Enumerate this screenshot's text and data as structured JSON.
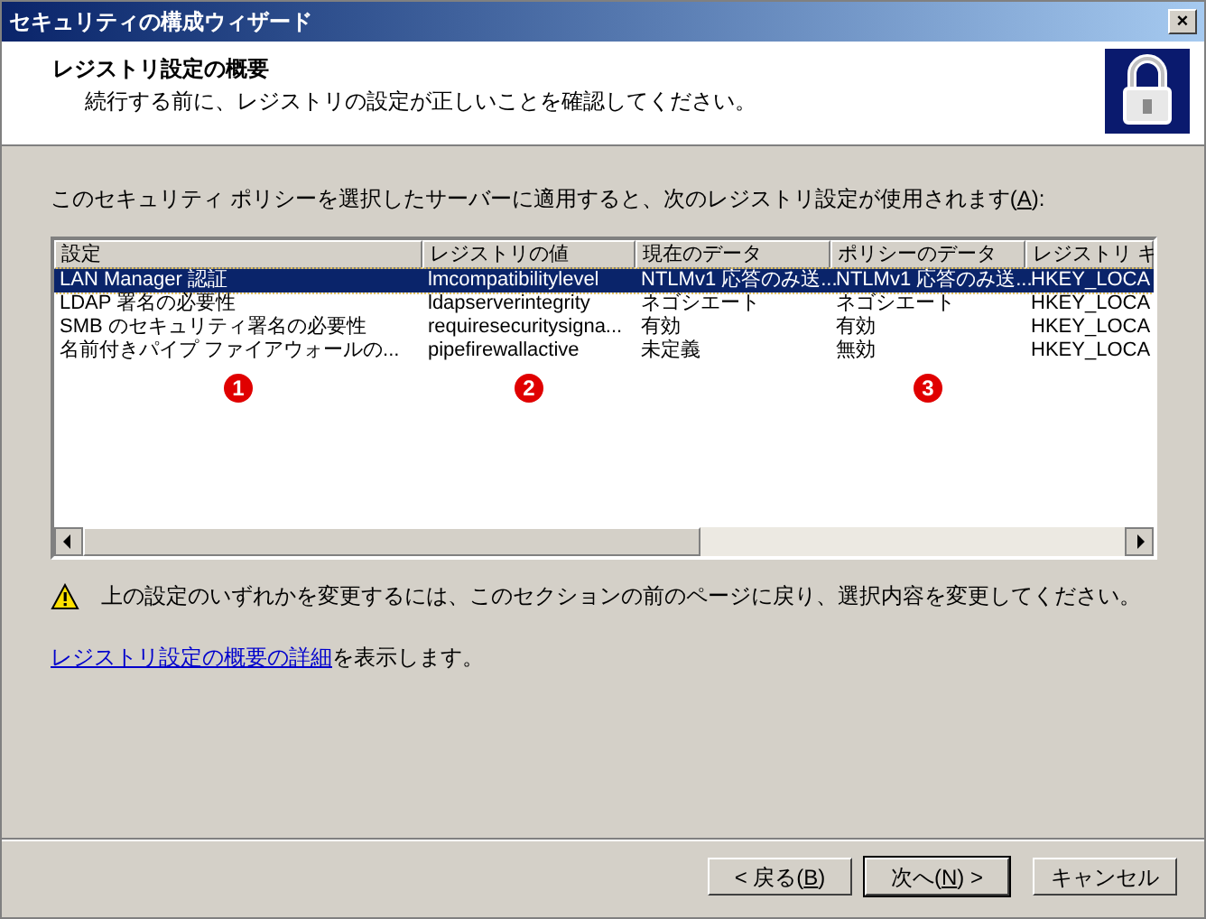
{
  "window": {
    "title": "セキュリティの構成ウィザード",
    "close": "×"
  },
  "header": {
    "title": "レジストリ設定の概要",
    "subtitle": "続行する前に、レジストリの設定が正しいことを確認してください。"
  },
  "intro": {
    "prefix": "このセキュリティ ポリシーを選択したサーバーに適用すると、次のレジストリ設定が使用されます(",
    "key": "A",
    "suffix": "):"
  },
  "table": {
    "columns": [
      "設定",
      "レジストリの値",
      "現在のデータ",
      "ポリシーのデータ",
      "レジストリ キ"
    ],
    "rows": [
      {
        "cells": [
          "LAN Manager 認証",
          "lmcompatibilitylevel",
          "NTLMv1 応答のみ送...",
          "NTLMv1 応答のみ送...",
          "HKEY_LOCA"
        ],
        "selected": true
      },
      {
        "cells": [
          "LDAP 署名の必要性",
          "ldapserverintegrity",
          "ネゴシエート",
          "ネゴシエート",
          "HKEY_LOCA"
        ],
        "selected": false
      },
      {
        "cells": [
          "SMB のセキュリティ署名の必要性",
          "requiresecuritysigna...",
          "有効",
          "有効",
          "HKEY_LOCA"
        ],
        "selected": false
      },
      {
        "cells": [
          "名前付きパイプ ファイアウォールの...",
          "pipefirewallactive",
          "未定義",
          "無効",
          "HKEY_LOCA"
        ],
        "selected": false
      }
    ],
    "markers": [
      "1",
      "2",
      "3"
    ]
  },
  "warning": "上の設定のいずれかを変更するには、このセクションの前のページに戻り、選択内容を変更してください。",
  "details": {
    "link": "レジストリ設定の概要の詳細",
    "suffix": "を表示します。"
  },
  "buttons": [
    {
      "prefix": "< 戻る(",
      "key": "B",
      "suffix": ")",
      "default": false
    },
    {
      "prefix": "次へ(",
      "key": "N",
      "suffix": ") >",
      "default": true
    },
    {
      "prefix": "キャンセル",
      "default": false
    }
  ]
}
